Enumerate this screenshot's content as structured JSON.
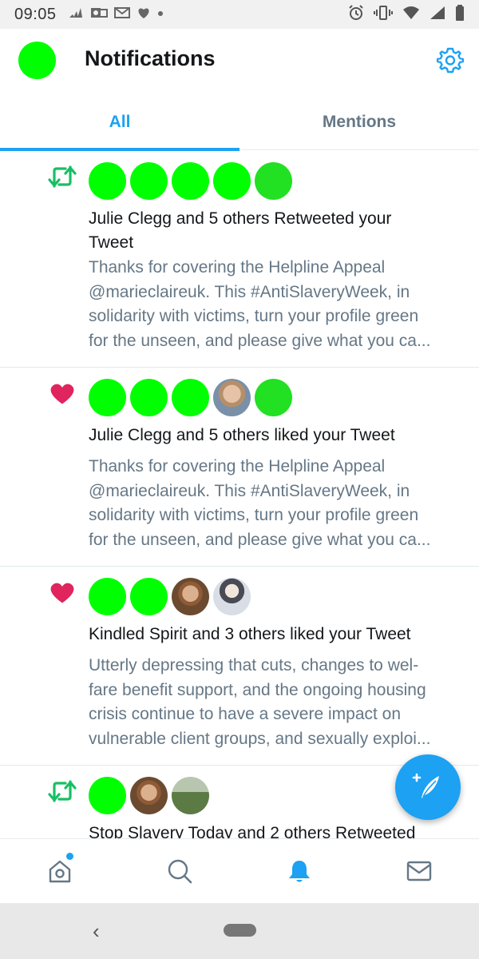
{
  "status_bar": {
    "time": "09:05"
  },
  "header": {
    "title": "Notifications"
  },
  "tabs": [
    {
      "label": "All",
      "active": true
    },
    {
      "label": "Mentions",
      "active": false
    }
  ],
  "notifications": [
    {
      "type": "retweet",
      "icon": "retweet-icon",
      "avatars": [
        "green",
        "green",
        "green",
        "green",
        "green"
      ],
      "title_lines": [
        "Julie Clegg and 5 others Retweeted your",
        "Tweet"
      ],
      "body_lines": [
        "Thanks for covering the Helpline Appeal",
        "@marieclaireuk. This #AntiSlaveryWeek, in",
        "solidarity with victims, turn your profile green",
        "for the unseen, and please give what you ca..."
      ]
    },
    {
      "type": "like",
      "icon": "heart-icon",
      "avatars": [
        "green",
        "green",
        "green",
        "photo",
        "green"
      ],
      "title_lines": [
        "Julie Clegg and 5 others liked your Tweet"
      ],
      "body_lines": [
        "Thanks for covering the Helpline Appeal",
        "@marieclaireuk. This #AntiSlaveryWeek, in",
        "solidarity with victims, turn your profile green",
        "for the unseen, and please give what you ca..."
      ]
    },
    {
      "type": "like",
      "icon": "heart-icon",
      "avatars": [
        "green",
        "green",
        "photo",
        "photo"
      ],
      "title_lines": [
        "Kindled Spirit and 3 others liked your Tweet"
      ],
      "body_lines": [
        "Utterly depressing that cuts, changes to wel-",
        "fare benefit support, and the ongoing housing",
        "crisis continue to have a severe impact on",
        "vulnerable client groups, and sexually exploi..."
      ]
    },
    {
      "type": "retweet",
      "icon": "retweet-icon",
      "avatars": [
        "green",
        "photo",
        "photo"
      ],
      "title_lines": [
        "Stop Slavery Today and 2 others Retweeted"
      ],
      "body_lines": []
    }
  ],
  "bottom_nav": [
    {
      "icon": "home-icon",
      "active": false,
      "has_dot": true
    },
    {
      "icon": "search-icon",
      "active": false
    },
    {
      "icon": "bell-icon",
      "active": true
    },
    {
      "icon": "mail-icon",
      "active": false
    }
  ],
  "fab": {
    "icon": "compose-tweet-icon"
  },
  "colors": {
    "accent": "#1da1f2",
    "retweet": "#17bf63",
    "like": "#e0245e",
    "avatar_green": "#00ff00",
    "secondary_text": "#657786"
  }
}
